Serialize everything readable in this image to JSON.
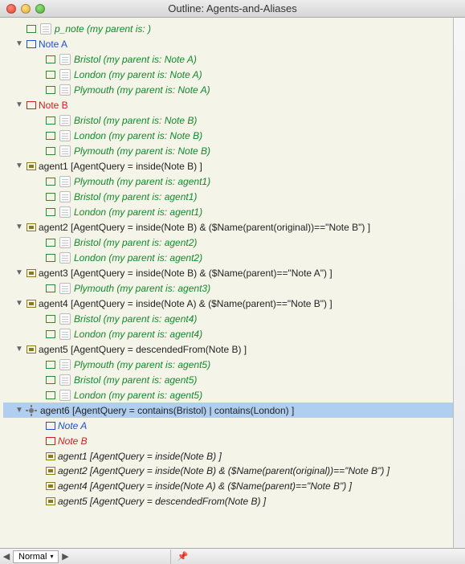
{
  "window": {
    "title": "Outline: Agents-and-Aliases"
  },
  "statusbar": {
    "mode": "Normal"
  },
  "rows": [
    {
      "depth": 0,
      "disclosure": "",
      "badge": "green",
      "icon": "note",
      "textClass": "green-text",
      "label": "p_note  (my parent is: )"
    },
    {
      "depth": 0,
      "disclosure": "▼",
      "badge": "blue",
      "icon": "",
      "textClass": "blue-text",
      "label": "Note A"
    },
    {
      "depth": 1,
      "disclosure": "",
      "badge": "green",
      "icon": "note",
      "textClass": "green-text",
      "label": "Bristol  (my parent is: Note A)"
    },
    {
      "depth": 1,
      "disclosure": "",
      "badge": "green",
      "icon": "note",
      "textClass": "green-text",
      "label": "London  (my parent is: Note A)"
    },
    {
      "depth": 1,
      "disclosure": "",
      "badge": "green",
      "icon": "note",
      "textClass": "green-text",
      "label": "Plymouth  (my parent is: Note A)"
    },
    {
      "depth": 0,
      "disclosure": "▼",
      "badge": "red",
      "icon": "",
      "textClass": "red-text",
      "label": "Note B"
    },
    {
      "depth": 1,
      "disclosure": "",
      "badge": "green",
      "icon": "note",
      "textClass": "green-text",
      "label": "Bristol  (my parent is: Note B)"
    },
    {
      "depth": 1,
      "disclosure": "",
      "badge": "green",
      "icon": "note",
      "textClass": "green-text",
      "label": "London  (my parent is: Note B)"
    },
    {
      "depth": 1,
      "disclosure": "",
      "badge": "green",
      "icon": "note",
      "textClass": "green-text",
      "label": "Plymouth  (my parent is: Note B)"
    },
    {
      "depth": 0,
      "disclosure": "▼",
      "badge": "olive-filled",
      "icon": "",
      "textClass": "black-text",
      "label": "agent1  [AgentQuery = inside(Note B) ]"
    },
    {
      "depth": 1,
      "disclosure": "",
      "badge": "green",
      "icon": "note",
      "textClass": "green-text",
      "label": "Plymouth  (my parent is: agent1)"
    },
    {
      "depth": 1,
      "disclosure": "",
      "badge": "green",
      "icon": "note",
      "textClass": "green-text",
      "label": "Bristol  (my parent is: agent1)"
    },
    {
      "depth": 1,
      "disclosure": "",
      "badge": "green",
      "icon": "note",
      "textClass": "green-text",
      "label": "London  (my parent is: agent1)"
    },
    {
      "depth": 0,
      "disclosure": "▼",
      "badge": "olive-filled",
      "icon": "",
      "textClass": "black-text",
      "label": "agent2  [AgentQuery = inside(Note B) & ($Name(parent(original))==\"Note B\") ]"
    },
    {
      "depth": 1,
      "disclosure": "",
      "badge": "green",
      "icon": "note",
      "textClass": "green-text",
      "label": "Bristol  (my parent is: agent2)"
    },
    {
      "depth": 1,
      "disclosure": "",
      "badge": "green",
      "icon": "note",
      "textClass": "green-text",
      "label": "London  (my parent is: agent2)"
    },
    {
      "depth": 0,
      "disclosure": "▼",
      "badge": "olive-filled",
      "icon": "",
      "textClass": "black-text",
      "label": "agent3  [AgentQuery = inside(Note B) & ($Name(parent)==\"Note A\") ]"
    },
    {
      "depth": 1,
      "disclosure": "",
      "badge": "green",
      "icon": "note",
      "textClass": "green-text",
      "label": "Plymouth  (my parent is: agent3)"
    },
    {
      "depth": 0,
      "disclosure": "▼",
      "badge": "olive-filled",
      "icon": "",
      "textClass": "black-text",
      "label": "agent4  [AgentQuery = inside(Note A) & ($Name(parent)==\"Note B\") ]"
    },
    {
      "depth": 1,
      "disclosure": "",
      "badge": "green",
      "icon": "note",
      "textClass": "green-text",
      "label": "Bristol  (my parent is: agent4)"
    },
    {
      "depth": 1,
      "disclosure": "",
      "badge": "green",
      "icon": "note",
      "textClass": "green-text",
      "label": "London  (my parent is: agent4)"
    },
    {
      "depth": 0,
      "disclosure": "▼",
      "badge": "olive-filled",
      "icon": "",
      "textClass": "black-text",
      "label": "agent5  [AgentQuery = descendedFrom(Note B) ]"
    },
    {
      "depth": 1,
      "disclosure": "",
      "badge": "green",
      "icon": "note",
      "textClass": "green-text",
      "label": "Plymouth  (my parent is: agent5)"
    },
    {
      "depth": 1,
      "disclosure": "",
      "badge": "green",
      "icon": "note",
      "textClass": "green-text",
      "label": "Bristol  (my parent is: agent5)"
    },
    {
      "depth": 1,
      "disclosure": "",
      "badge": "green",
      "icon": "note",
      "textClass": "green-text",
      "label": "London  (my parent is: agent5)"
    },
    {
      "depth": 0,
      "disclosure": "▼",
      "badge": "gear",
      "icon": "",
      "textClass": "black-text",
      "label": "agent6  [AgentQuery = contains(Bristol) | contains(London) ]",
      "selected": true
    },
    {
      "depth": 1,
      "disclosure": "",
      "badge": "blue",
      "icon": "",
      "textClass": "blue-text italic",
      "label": "Note A"
    },
    {
      "depth": 1,
      "disclosure": "",
      "badge": "red",
      "icon": "",
      "textClass": "red-text italic",
      "label": "Note B"
    },
    {
      "depth": 1,
      "disclosure": "",
      "badge": "olive-filled",
      "icon": "",
      "textClass": "black-italic",
      "label": "agent1  [AgentQuery = inside(Note B) ]"
    },
    {
      "depth": 1,
      "disclosure": "",
      "badge": "olive-filled",
      "icon": "",
      "textClass": "black-italic",
      "wrap": true,
      "label": "agent2  [AgentQuery = inside(Note B) & ($Name(parent(original))==\"Note B\") ]"
    },
    {
      "depth": 1,
      "disclosure": "",
      "badge": "olive-filled",
      "icon": "",
      "textClass": "black-italic",
      "label": "agent4  [AgentQuery = inside(Note A) & ($Name(parent)==\"Note B\") ]"
    },
    {
      "depth": 1,
      "disclosure": "",
      "badge": "olive-filled",
      "icon": "",
      "textClass": "black-italic",
      "label": "agent5  [AgentQuery = descendedFrom(Note B) ]"
    }
  ]
}
